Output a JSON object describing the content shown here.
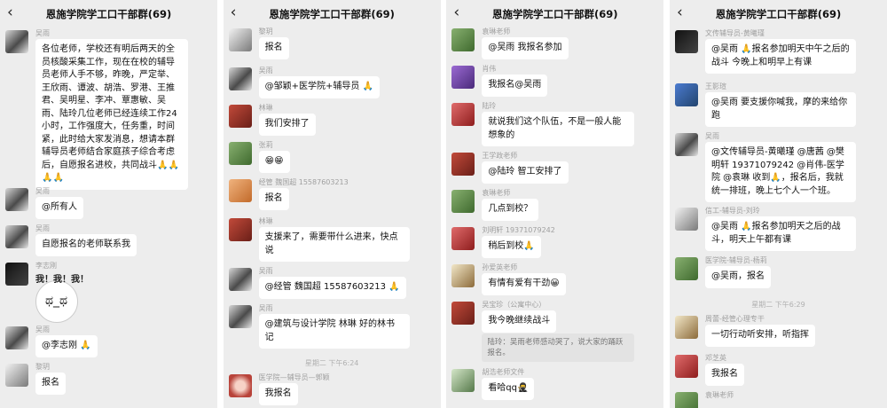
{
  "panels": [
    {
      "title": "恩施学院学工口干部群(69)",
      "messages": [
        {
          "sender": "吴雨",
          "text": "各位老师，学校还有明后两天的全员核酸采集工作，现在在校的辅导员老师人手不够，昨晚，严定举、王欣雨、谭波、胡浩、罗港、王推君、吴明星、李冲、覃惠敏、吴雨、陆玲几位老师已经连续工作24小时，工作强度大，任务重，时间紧，此时给大家发消息，想请本群辅导员老师结合家庭孩子综合考虑后，自愿报名进校，共同战斗🙏🙏🙏🙏"
        },
        {
          "sender": "吴雨",
          "text": "@所有人"
        },
        {
          "sender": "吴雨",
          "text": "自愿报名的老师联系我"
        },
        {
          "sender": "李志刚",
          "text": "我！我！我！"
        },
        {
          "sender": "吴雨",
          "text": "@李志刚 🙏"
        },
        {
          "sender": "黎玥",
          "text": "报名"
        }
      ]
    },
    {
      "title": "恩施学院学工口干部群(69)",
      "messages": [
        {
          "sender": "黎玥",
          "text": "报名"
        },
        {
          "sender": "吴雨",
          "text": "@邹颖+医学院+辅导员 🙏"
        },
        {
          "sender": "林琳",
          "text": "我们安排了"
        },
        {
          "sender": "张莉",
          "text": "😁😁"
        },
        {
          "sender": "经管 魏国超 15587603213",
          "text": "报名"
        },
        {
          "sender": "林琳",
          "text": "支援来了，需要带什么进来，快点说"
        },
        {
          "sender": "吴雨",
          "text": "@经管 魏国超 15587603213 🙏"
        },
        {
          "sender": "吴雨",
          "text": "@建筑与设计学院 林琳 好的林书记"
        },
        {
          "sender": "医学院—辅导员—郭颖",
          "text": "我报名"
        }
      ],
      "timestamp": "星期二 下午6:24"
    },
    {
      "title": "恩施学院学工口干部群(69)",
      "messages": [
        {
          "sender": "袁琳老师",
          "text": "@吴雨 我报名参加"
        },
        {
          "sender": "肖伟",
          "text": "我报名@吴雨"
        },
        {
          "sender": "陆玲",
          "text": "就说我们这个队伍，不是一般人能想象的"
        },
        {
          "sender": "王学政老师",
          "text": "@陆玲 智工安排了"
        },
        {
          "sender": "袁琳老师",
          "text": "几点到校？"
        },
        {
          "sender": "刘明轩 19371079242",
          "text": "稍后到校🙏"
        },
        {
          "sender": "孙爱英老师",
          "text": "有情有爱有干劲😀"
        },
        {
          "sender": "吴宝珍（公寓中心）",
          "text": "我今晚继续战斗"
        },
        {
          "sender": "胡浩老师文件",
          "text": "看哈qq🥷"
        }
      ],
      "system_note": "陆玲：吴雨老师感动哭了，说大家的踊跃报名。"
    },
    {
      "title": "恩施学院学工口干部群(69)",
      "messages": [
        {
          "sender": "文传辅导员-黄曦瑾",
          "text": "@吴雨 🙏报名参加明天中午之后的战斗 今晚上和明早上有课"
        },
        {
          "sender": "王影瑄",
          "text": "@吴雨 要支援你喊我，摩的来给你跑"
        },
        {
          "sender": "吴雨",
          "text": "@文传辅导员-黄曦瑾 @唐茜 @樊明轩 19371079242 @肖伟-医学院 @袁琳 收到🙏，报名后，我就统一排班，晚上七个人一个班。"
        },
        {
          "sender": "信工-辅导员-刘玲",
          "text": "@吴雨 🙏报名参加明天之后的战斗，明天上午都有课"
        },
        {
          "sender": "医学院-辅导员-杨莉",
          "text": "@吴雨，报名"
        },
        {
          "sender": "周蕾-经管心理专干",
          "text": "一切行动听安排，听指挥"
        },
        {
          "sender": "邓芝英",
          "text": "我报名"
        },
        {
          "sender": "袁琳老师",
          "text": ""
        }
      ],
      "timestamp": "星期二 下午6:29"
    }
  ]
}
